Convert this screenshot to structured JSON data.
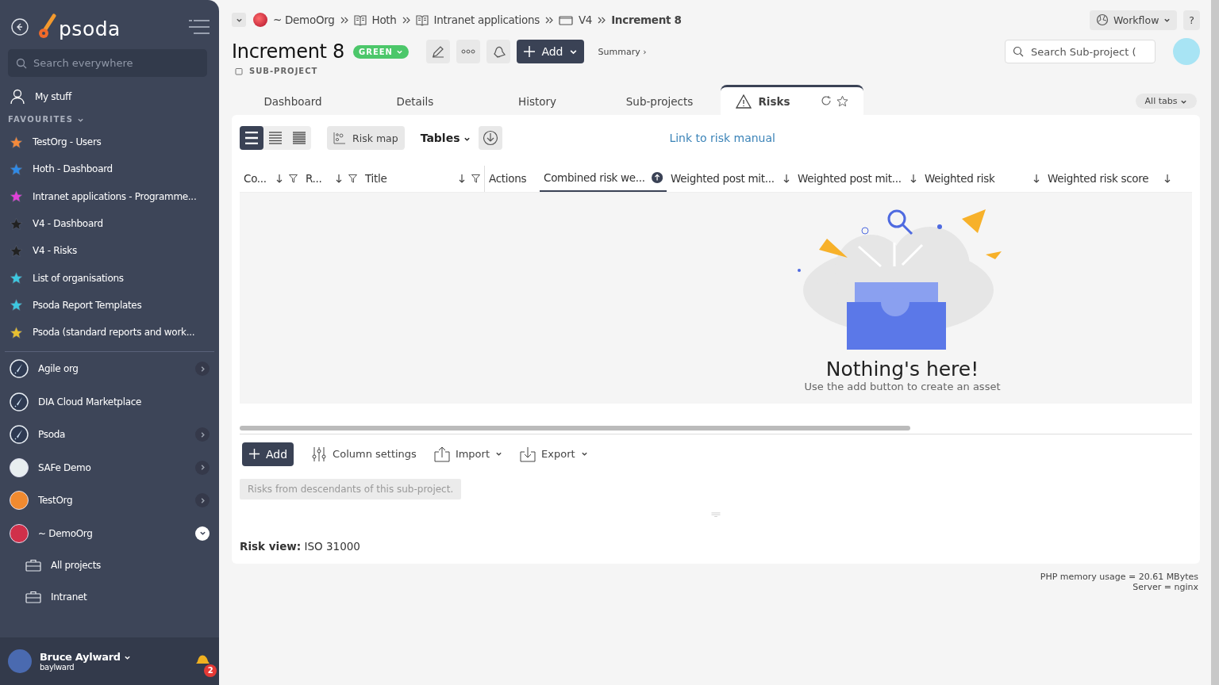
{
  "sidebar": {
    "logo": "psoda",
    "search": {
      "placeholder": "Search everywhere"
    },
    "my_stuff": "My stuff",
    "favourites_heading": "FAVOURITES",
    "favourites": [
      {
        "label": "TestOrg - Users",
        "color": "#f58a3a"
      },
      {
        "label": "Hoth - Dashboard",
        "color": "#2f8ae6"
      },
      {
        "label": "Intranet applications - Programme...",
        "color": "#e040d8"
      },
      {
        "label": "V4 - Dashboard",
        "color": "#222222"
      },
      {
        "label": "V4 - Risks",
        "color": "#222222"
      },
      {
        "label": "List of organisations",
        "color": "#3cc8e0"
      },
      {
        "label": "Psoda Report Templates",
        "color": "#3cc8e0"
      },
      {
        "label": "Psoda (standard reports and work...",
        "color": "#e8c030"
      }
    ],
    "organisations": [
      {
        "name": "Agile org",
        "kind": "rocket",
        "expanded": false
      },
      {
        "name": "DIA Cloud Marketplace",
        "kind": "rocket"
      },
      {
        "name": "Psoda",
        "kind": "rocket",
        "expanded": false
      },
      {
        "name": "SAFe Demo",
        "kind": "logo",
        "color": "#e8eef0",
        "expanded": false
      },
      {
        "name": "TestOrg",
        "kind": "logo",
        "color": "#f08a30",
        "expanded": false
      },
      {
        "name": "~ DemoOrg",
        "kind": "logo",
        "color": "#d0304a",
        "expanded": true,
        "children": [
          {
            "label": "All projects"
          },
          {
            "label": "Intranet"
          }
        ]
      }
    ],
    "user": {
      "name": "Bruce Aylward",
      "username": "baylward",
      "notifications": "2"
    }
  },
  "breadcrumbs": [
    {
      "label": "~ DemoOrg",
      "kind": "org"
    },
    {
      "label": "Hoth",
      "kind": "book"
    },
    {
      "label": "Intranet applications",
      "kind": "book"
    },
    {
      "label": "V4",
      "kind": "folder"
    },
    {
      "label": "Increment 8",
      "kind": "current"
    }
  ],
  "header": {
    "title": "Increment 8",
    "status": "GREEN",
    "type": "SUB-PROJECT",
    "add": "Add",
    "summary": "Summary ›",
    "workflow": "Workflow",
    "help": "?",
    "search": {
      "placeholder": "Search Sub-project ("
    }
  },
  "tabs": [
    {
      "label": "Dashboard",
      "selected": false
    },
    {
      "label": "Details",
      "selected": false
    },
    {
      "label": "History",
      "selected": false
    },
    {
      "label": "Sub-projects",
      "selected": false
    },
    {
      "label": "Risks",
      "selected": true
    }
  ],
  "all_tabs": "All tabs",
  "toolbar": {
    "view_modes": [
      {
        "selected": true
      },
      {
        "selected": false
      },
      {
        "selected": false
      }
    ],
    "risk_map": "Risk map",
    "tables": "Tables",
    "link": "Link to risk manual"
  },
  "table": {
    "columns": [
      {
        "label": "Co...",
        "sortable": true,
        "filterable": true,
        "sorted": false
      },
      {
        "label": "R...",
        "sortable": true,
        "filterable": true,
        "sorted": false
      },
      {
        "label": "Title",
        "sortable": true,
        "filterable": true,
        "sorted": false
      },
      {
        "label": "Actions",
        "sortable": false,
        "filterable": false,
        "sorted": false
      },
      {
        "label": "Combined risk we...",
        "sortable": false,
        "filterable": false,
        "sorted": true
      },
      {
        "label": "Weighted post mit...",
        "sortable": true,
        "filterable": false,
        "sorted": false
      },
      {
        "label": "Weighted post mit...",
        "sortable": true,
        "filterable": false,
        "sorted": false
      },
      {
        "label": "Weighted risk",
        "sortable": true,
        "filterable": false,
        "sorted": false
      },
      {
        "label": "Weighted risk score",
        "sortable": true,
        "filterable": false,
        "sorted": false
      }
    ],
    "empty_title": "Nothing's here!",
    "empty_text": "Use the add button to create an asset"
  },
  "actions": {
    "add": "Add",
    "column_settings": "Column settings",
    "import": "Import",
    "export": "Export"
  },
  "note": "Risks from descendants of this sub-project.",
  "risk_view": {
    "label": "Risk view:",
    "value": "ISO 31000"
  },
  "footer": [
    "PHP memory usage = 20.61 MBytes",
    "Server = nginx"
  ]
}
